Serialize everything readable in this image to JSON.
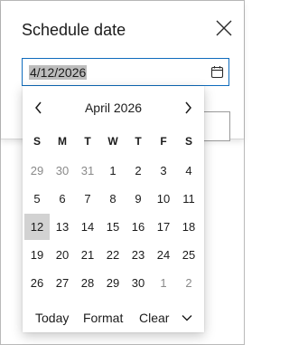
{
  "dialog": {
    "title": "Schedule date"
  },
  "date_field": {
    "value": "4/12/2026"
  },
  "calendar": {
    "month_label": "April 2026",
    "weekdays": [
      "S",
      "M",
      "T",
      "W",
      "T",
      "F",
      "S"
    ],
    "days": [
      {
        "label": "29",
        "other_month": true
      },
      {
        "label": "30",
        "other_month": true
      },
      {
        "label": "31",
        "other_month": true
      },
      {
        "label": "1"
      },
      {
        "label": "2"
      },
      {
        "label": "3"
      },
      {
        "label": "4"
      },
      {
        "label": "5"
      },
      {
        "label": "6"
      },
      {
        "label": "7"
      },
      {
        "label": "8"
      },
      {
        "label": "9"
      },
      {
        "label": "10"
      },
      {
        "label": "11"
      },
      {
        "label": "12",
        "selected": true
      },
      {
        "label": "13"
      },
      {
        "label": "14"
      },
      {
        "label": "15"
      },
      {
        "label": "16"
      },
      {
        "label": "17"
      },
      {
        "label": "18"
      },
      {
        "label": "19"
      },
      {
        "label": "20"
      },
      {
        "label": "21"
      },
      {
        "label": "22"
      },
      {
        "label": "23"
      },
      {
        "label": "24"
      },
      {
        "label": "25"
      },
      {
        "label": "26"
      },
      {
        "label": "27"
      },
      {
        "label": "28"
      },
      {
        "label": "29"
      },
      {
        "label": "30"
      },
      {
        "label": "1",
        "other_month": true
      },
      {
        "label": "2",
        "other_month": true
      }
    ],
    "footer": {
      "today": "Today",
      "format": "Format",
      "clear": "Clear"
    }
  },
  "icons": {
    "close": "close-icon",
    "calendar": "calendar-icon",
    "prev": "chevron-left-icon",
    "next": "chevron-right-icon",
    "expand": "chevron-down-icon"
  },
  "colors": {
    "focus_border": "#0f6cbd",
    "selected_day_bg": "#d2d2d2",
    "selected_text_bg": "#bdbdbd",
    "muted_text": "#8a8a8a"
  }
}
